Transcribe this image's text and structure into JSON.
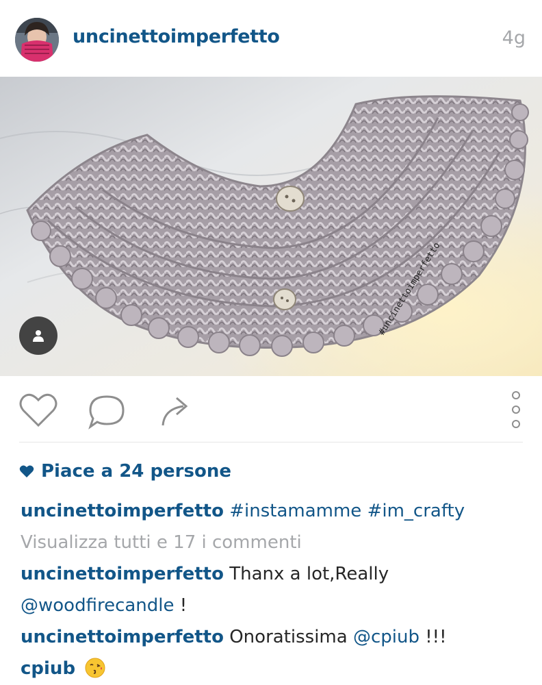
{
  "post": {
    "username": "uncinettoimperfetto",
    "time_ago": "4g"
  },
  "photo": {
    "watermark": "#uncinettoimperfetto"
  },
  "likes": {
    "text": "Piace a 24 persone"
  },
  "caption": {
    "username": "uncinettoimperfetto",
    "hashtag1": "#instamamme",
    "hashtag2": "#im_crafty"
  },
  "view_all": "Visualizza tutti e 17 i commenti",
  "comments": [
    {
      "username": "uncinettoimperfetto",
      "text": "Thanx a lot,Really",
      "mention": "@woodfirecandle",
      "suffix": "!"
    },
    {
      "username": "uncinettoimperfetto",
      "text": "Onoratissima",
      "mention": "@cpiub",
      "suffix": "!!!"
    },
    {
      "username": "cpiub",
      "emoji": "kissing-face-emoji"
    }
  ],
  "colors": {
    "accent": "#125688",
    "muted": "#a5a7aa",
    "text": "#262626"
  }
}
